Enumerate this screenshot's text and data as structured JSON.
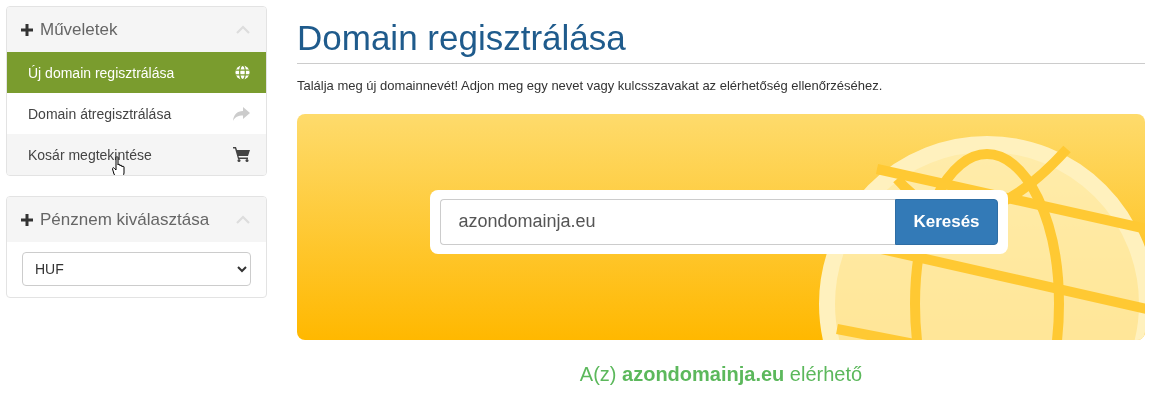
{
  "sidebar": {
    "panels": [
      {
        "kind": "menu",
        "title": "Műveletek",
        "expanded": true,
        "items": [
          {
            "label": "Új domain regisztrálása",
            "selected": true,
            "hovered": false
          },
          {
            "label": "Domain átregisztrálása",
            "selected": false,
            "hovered": false
          },
          {
            "label": "Kosár megtekintése",
            "selected": false,
            "hovered": true
          }
        ]
      },
      {
        "kind": "select",
        "title": "Pénznem kiválasztása",
        "expanded": true,
        "value": "HUF"
      }
    ]
  },
  "main": {
    "title": "Domain regisztrálása",
    "description": "Találja meg új domainnevét! Adjon meg egy nevet vagy kulcsszavakat az elérhetőség ellenőrzéséhez.",
    "search": {
      "value": "azondomainja.eu",
      "button": "Keresés"
    },
    "result": "A(z) **azondomainja.eu** elérhető"
  }
}
